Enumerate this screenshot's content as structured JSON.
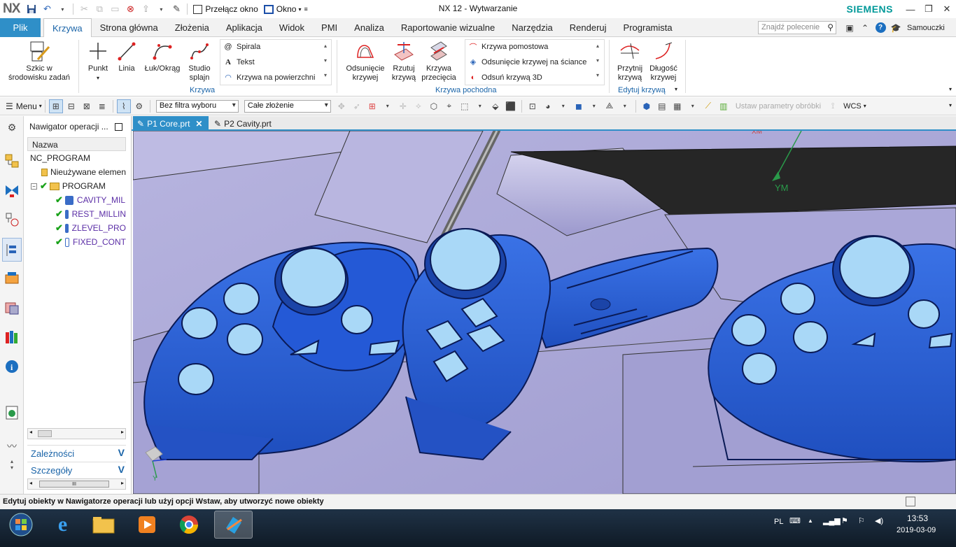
{
  "app": {
    "logo": "NX",
    "title": "NX 12 - Wytwarzanie",
    "brand": "SIEMENS",
    "quick_access": {
      "switch_window": "Przełącz okno",
      "window": "Okno"
    }
  },
  "menu_tabs": {
    "file": "Plik",
    "items": [
      "Krzywa",
      "Strona główna",
      "Złożenia",
      "Aplikacja",
      "Widok",
      "PMI",
      "Analiza",
      "Raportowanie wizualne",
      "Narzędzia",
      "Renderuj",
      "Programista"
    ],
    "active": "Krzywa",
    "command_finder_placeholder": "Znajdź polecenie",
    "help": "?",
    "tutorials": "Samouczki"
  },
  "ribbon": {
    "sketch": "Szkic w\nśrodowisku zadań",
    "point": "Punkt",
    "line": "Linia",
    "arc": "Łuk/Okrąg",
    "spline": "Studio\nsplajn",
    "spiral": "Spirala",
    "text": "Tekst",
    "curve_on_surface": "Krzywa na powierzchni",
    "group_curve": "Krzywa",
    "offset_curve": "Odsunięcie\nkrzywej",
    "project_curve": "Rzutuj\nkrzywą",
    "intersection_curve": "Krzywa\nprzecięcia",
    "bridge_curve": "Krzywa pomostowa",
    "offset_in_face": "Odsunięcie krzywej na ściance",
    "offset_3d": "Odsuń krzywą 3D",
    "group_derived": "Krzywa pochodna",
    "trim_curve": "Przytnij\nkrzywą",
    "curve_length": "Długość\nkrzywej",
    "group_edit": "Edytuj krzywą"
  },
  "toolbar": {
    "menu": "Menu",
    "selection_filter": "Bez filtra wyboru",
    "assembly_scope": "Całe złożenie",
    "set_machining_params": "Ustaw parametry obróbki",
    "wcs": "WCS"
  },
  "navigator": {
    "title": "Nawigator operacji ...",
    "column": "Nazwa",
    "root": "NC_PROGRAM",
    "unused": "Nieużywane elemen",
    "program": "PROGRAM",
    "operations": [
      "CAVITY_MIL",
      "REST_MILLIN",
      "ZLEVEL_PRO",
      "FIXED_CONT"
    ],
    "panel_dependencies": "Zależności",
    "panel_details": "Szczegóły",
    "scroll_thumb": "III"
  },
  "doc_tabs": [
    "P1 Core.prt",
    "P2 Cavity.prt"
  ],
  "viewport": {
    "axis_ym": "YM",
    "axis_xm": "XM",
    "axis_y": "Y"
  },
  "status": "Edytuj obiekty w Nawigatorze operacji lub użyj opcji Wstaw, aby utworzyć nowe obiekty",
  "taskbar": {
    "lang": "PL",
    "time": "13:53",
    "date": "2019-03-09"
  },
  "colors": {
    "accent": "#2f8fc8",
    "part_blue": "#2f62d8",
    "mold_lavender": "#a8a6d6",
    "siemens": "#009999"
  }
}
